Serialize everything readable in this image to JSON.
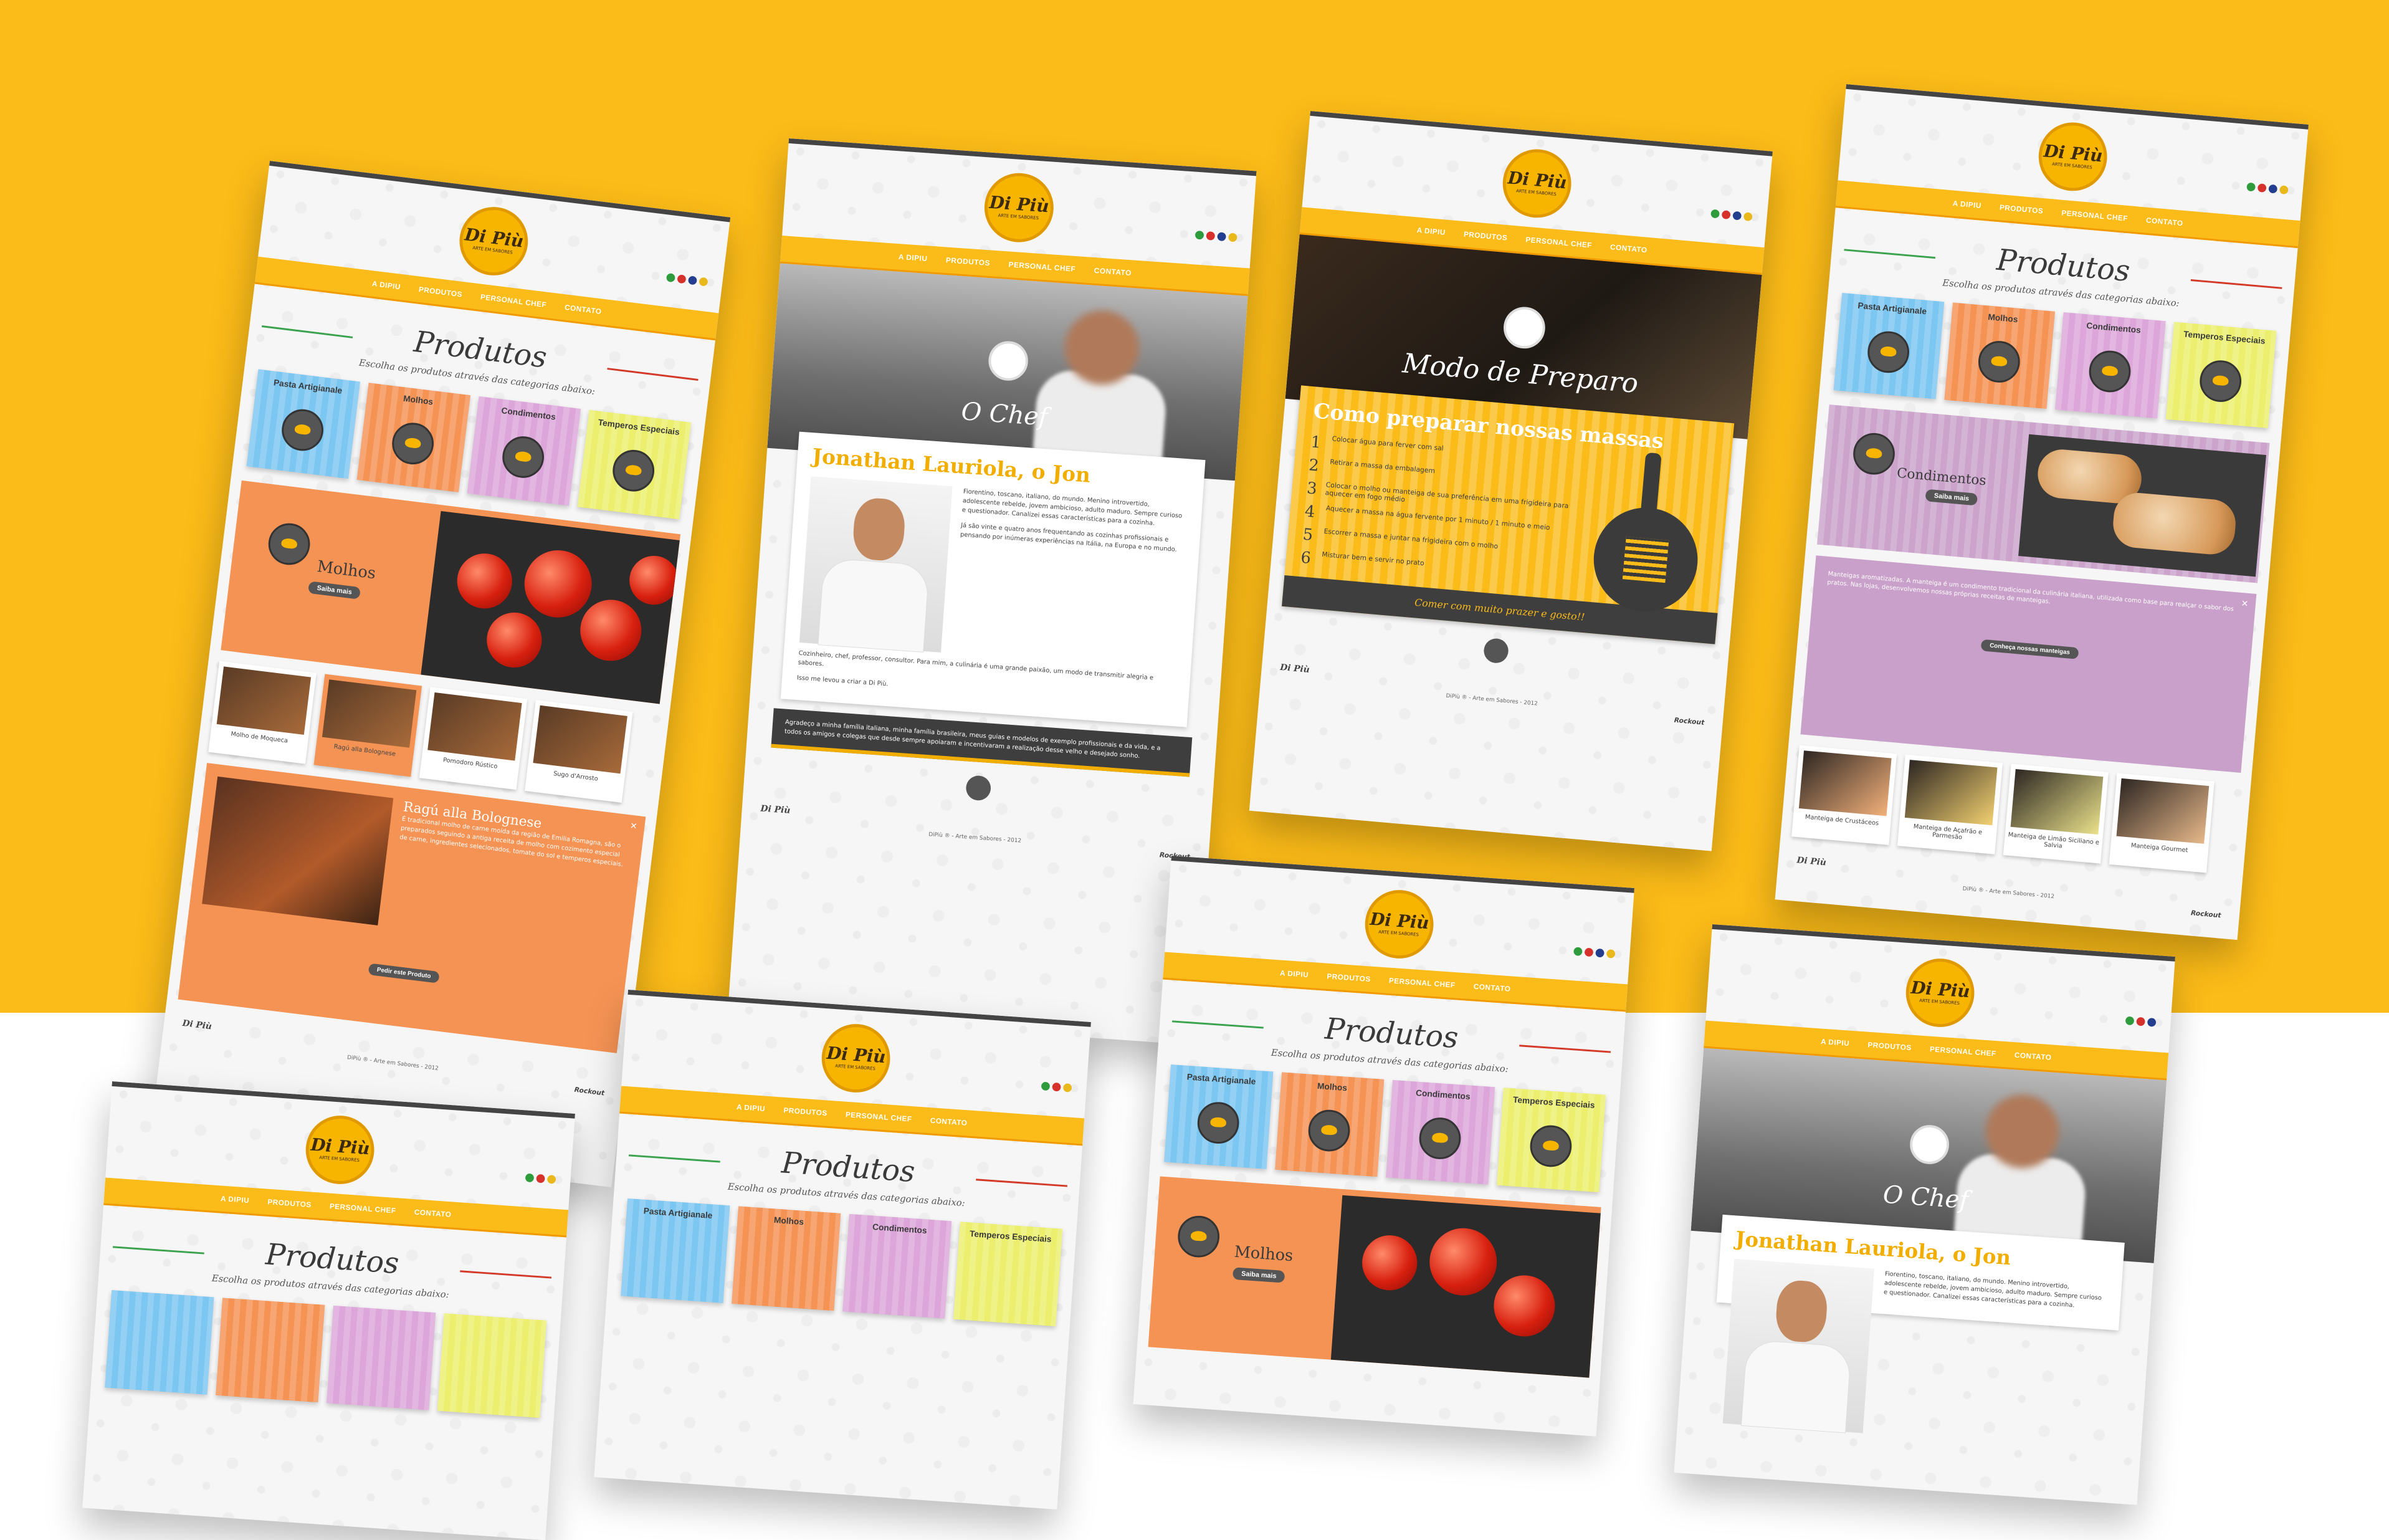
{
  "colors": {
    "background_top": "#fbbb18",
    "background_bottom": "#ffffff",
    "brand_yellow": "#fbbb18",
    "pasta_blue": "#7cc6f2",
    "molhos_orange": "#f59354",
    "condimentos_purple": "#dda6da",
    "temperos_lime": "#ecef6d",
    "dark_gray": "#3e3e3e"
  },
  "brand": {
    "logo_text": "Di Più",
    "logo_sub": "ARTE EM SABORES",
    "footer_logo": "Di Più",
    "copyright": "DiPiù ® - Arte em Sabores - 2012",
    "signature": "Rockout"
  },
  "nav": {
    "item_1": "A DIPIU",
    "item_2": "PRODUTOS",
    "item_3": "PERSONAL CHEF",
    "item_4": "CONTATO"
  },
  "flags": [
    {
      "name": "brazil-flag",
      "color": "#2e9b3d"
    },
    {
      "name": "italy-flag",
      "color": "#d7312b"
    },
    {
      "name": "uk-flag",
      "color": "#243e8f"
    },
    {
      "name": "spain-flag",
      "color": "#e9b81a"
    }
  ],
  "produtos": {
    "title": "Produtos",
    "subtitle": "Escolha os produtos através das categorias abaixo:",
    "categories": {
      "pasta": "Pasta Artigianale",
      "molhos": "Molhos",
      "condimentos": "Condimentos",
      "temperos": "Temperos Especiais"
    },
    "hero": {
      "title": "Molhos",
      "button": "Saiba mais"
    },
    "thumbs": {
      "t1": "Molho de Moqueca",
      "t2": "Ragú alla Bolognese",
      "t3": "Pomodoro Rústico",
      "t4": "Sugo d'Arrosto"
    },
    "detail": {
      "title": "Ragú alla Bolognese",
      "text": "É tradicional molho de carne moída da região de Emilia Romagna, são o preparados seguindo a antiga receita de molho com cozimento especial de carne, ingredientes selecionados, tomate do sol e temperos especiais.",
      "button": "Pedir este Produto",
      "close": "✕"
    }
  },
  "chef": {
    "title": "O Chef",
    "name": "Jonathan Lauriola, o Jon",
    "bio_1": "Fiorentino, toscano, italiano, do mundo. Menino introvertido, adolescente rebelde, jovem ambicioso, adulto maduro. Sempre curioso e questionador. Canalizei essas características para a cozinha.",
    "bio_2": "Já são vinte e quatro anos frequentando as cozinhas profissionais e pensando por inúmeras experiências na Itália, na Europa e no mundo.",
    "bio_3": "Cozinheiro, chef, professor, consultor. Para mim, a culinária é uma grande paixão, um modo de transmitir alegria e sabores.",
    "bio_4": "Isso me levou a criar a Di Più.",
    "quote": "Agradeço a minha família italiana, minha família brasileira, meus guias e modelos de exemplo profissionais e da vida, e a todos os amigos e colegas que desde sempre apoiaram e incentivaram a realização desse velho e desejado sonho."
  },
  "preparo": {
    "title": "Modo de Preparo",
    "heading": "Como preparar nossas massas",
    "steps": [
      {
        "num": "1",
        "text": "Colocar água para ferver com sal"
      },
      {
        "num": "2",
        "text": "Retirar a massa da embalagem"
      },
      {
        "num": "3",
        "text": "Colocar o molho ou manteiga de sua preferência em uma frigideira para aquecer em fogo médio"
      },
      {
        "num": "4",
        "text": "Aquecer a massa na água fervente por 1 minuto / 1 minuto e meio"
      },
      {
        "num": "5",
        "text": "Escorrer a massa e juntar na frigideira com o molho"
      },
      {
        "num": "6",
        "text": "Misturar bem e servir no prato"
      }
    ],
    "footer": "Comer com muito prazer e gosto!!"
  },
  "condimentos": {
    "title": "Condimentos",
    "button": "Saiba mais",
    "text": "Manteigas aromatizadas. A manteiga é um condimento tradicional da culinária italiana, utilizada como base para realçar o sabor dos pratos. Nas lojas, desenvolvemos nossas próprias receitas de manteigas.",
    "cta": "Conheça nossas manteigas",
    "thumbs": {
      "t1": "Manteiga de Crustáceos",
      "t2": "Manteiga de Açafrão e Parmesão",
      "t3": "Manteiga de Limão Siciliano e Salvia",
      "t4": "Manteiga Gourmet"
    },
    "close": "✕"
  }
}
